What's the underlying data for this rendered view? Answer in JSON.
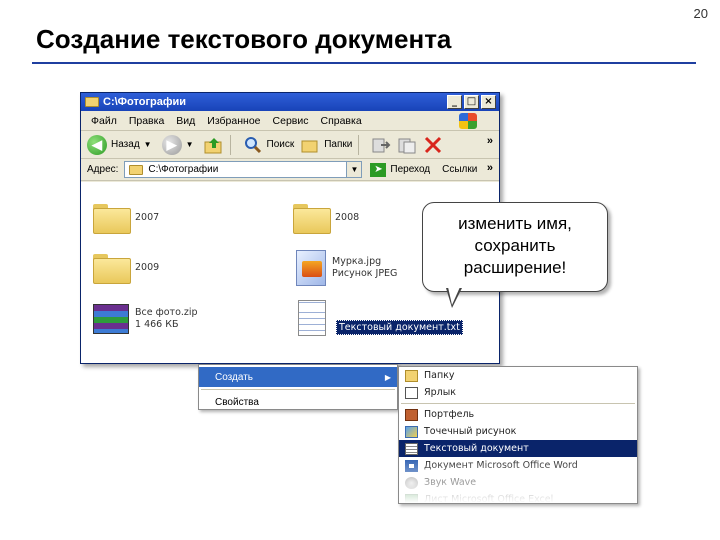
{
  "slide": {
    "number": "20",
    "title": "Создание текстового документа"
  },
  "window": {
    "title": "C:\\Фотографии",
    "min": "_",
    "max": "□",
    "close": "×",
    "menu": [
      "Файл",
      "Правка",
      "Вид",
      "Избранное",
      "Сервис",
      "Справка"
    ],
    "toolbar": {
      "back": "Назад",
      "search": "Поиск",
      "folders": "Папки",
      "more": "»"
    },
    "address": {
      "label": "Адрес:",
      "value": "C:\\Фотографии",
      "go": "Переход",
      "links": "Ссылки",
      "more": "»"
    },
    "items": [
      {
        "name": "2007"
      },
      {
        "name": "2008"
      },
      {
        "name": "2009"
      },
      {
        "name": "Мурка.jpg",
        "detail": "Рисунок JPEG"
      },
      {
        "name": "Все фото.zip",
        "detail": "1 466 КБ"
      },
      {
        "name": "Текстовый документ.txt"
      }
    ]
  },
  "callout": {
    "line1": "изменить имя,",
    "line2": "сохранить",
    "line3": "расширение!"
  },
  "context_menu": {
    "items": [
      "Создать",
      "Свойства"
    ]
  },
  "submenu": {
    "items": [
      "Папку",
      "Ярлык",
      "Портфель",
      "Точечный рисунок",
      "Текстовый документ",
      "Документ Microsoft Office Word",
      "Звук Wave",
      "Лист Microsoft Office Excel"
    ]
  },
  "colors": {
    "title_rule": "#1f3fa0",
    "titlebar": "#2f5fd8",
    "highlight": "#0a246a"
  }
}
